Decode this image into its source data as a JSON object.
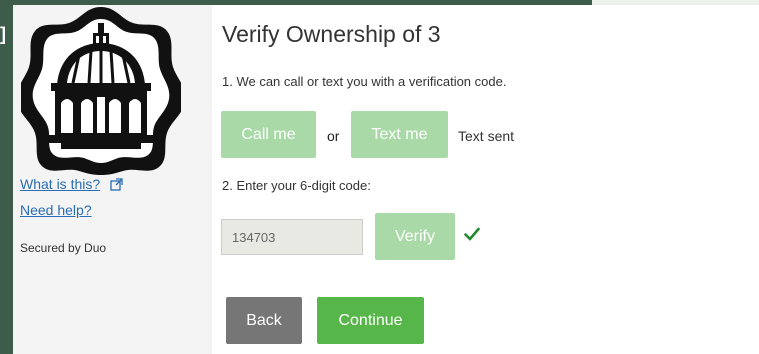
{
  "sidebar": {
    "logo": "building-dome-logo",
    "what_is_this": "What is this?",
    "need_help": "Need help?",
    "secured_by": "Secured by Duo"
  },
  "main": {
    "title": "Verify Ownership of 3",
    "step1": "1. We can call or text you with a verification code.",
    "call_label": "Call me",
    "or_label": "or",
    "text_label": "Text me",
    "text_sent": "Text sent",
    "step2": "2. Enter your 6-digit code:",
    "code_value": "134703",
    "verify_label": "Verify",
    "back_label": "Back",
    "continue_label": "Continue"
  },
  "colors": {
    "accent_green": "#57b649",
    "disabled_green": "#a8d9a6",
    "back_gray": "#767676",
    "link_blue": "#2a6db3",
    "check_green": "#1f8a2e"
  },
  "icons": {
    "external_link": "external-link-icon",
    "verified": "checkmark-icon"
  }
}
